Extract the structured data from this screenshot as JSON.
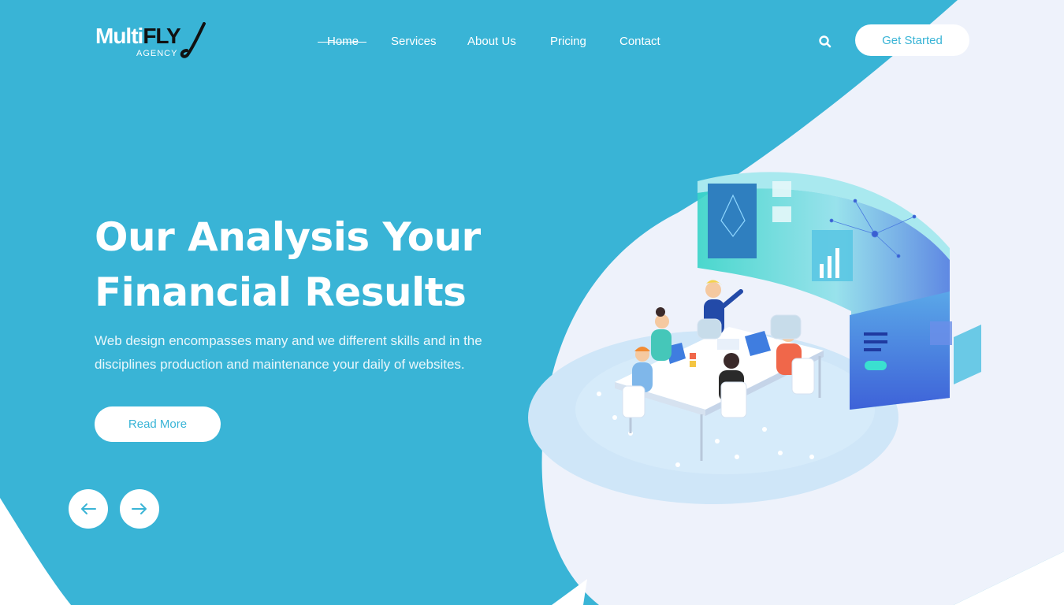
{
  "logo": {
    "main": "Multi",
    "accent": "FLY",
    "sub": "AGENCY"
  },
  "nav": {
    "items": [
      {
        "label": "Home",
        "active": true
      },
      {
        "label": "Services",
        "active": false
      },
      {
        "label": "About Us",
        "active": false
      },
      {
        "label": "Pricing",
        "active": false
      },
      {
        "label": "Contact",
        "active": false
      }
    ]
  },
  "header": {
    "search_icon": "search-icon",
    "cta_label": "Get Started"
  },
  "hero": {
    "title_line1": "Our Analysis Your",
    "title_line2": "Financial Results",
    "description": "Web design encompasses many and we different skills and in the disciplines production and maintenance your daily of websites.",
    "button_label": "Read More"
  },
  "slider": {
    "prev_icon": "arrow-left-icon",
    "next_icon": "arrow-right-icon"
  },
  "colors": {
    "primary": "#39b4d6",
    "background_light": "#eef2fb",
    "white": "#ffffff"
  }
}
